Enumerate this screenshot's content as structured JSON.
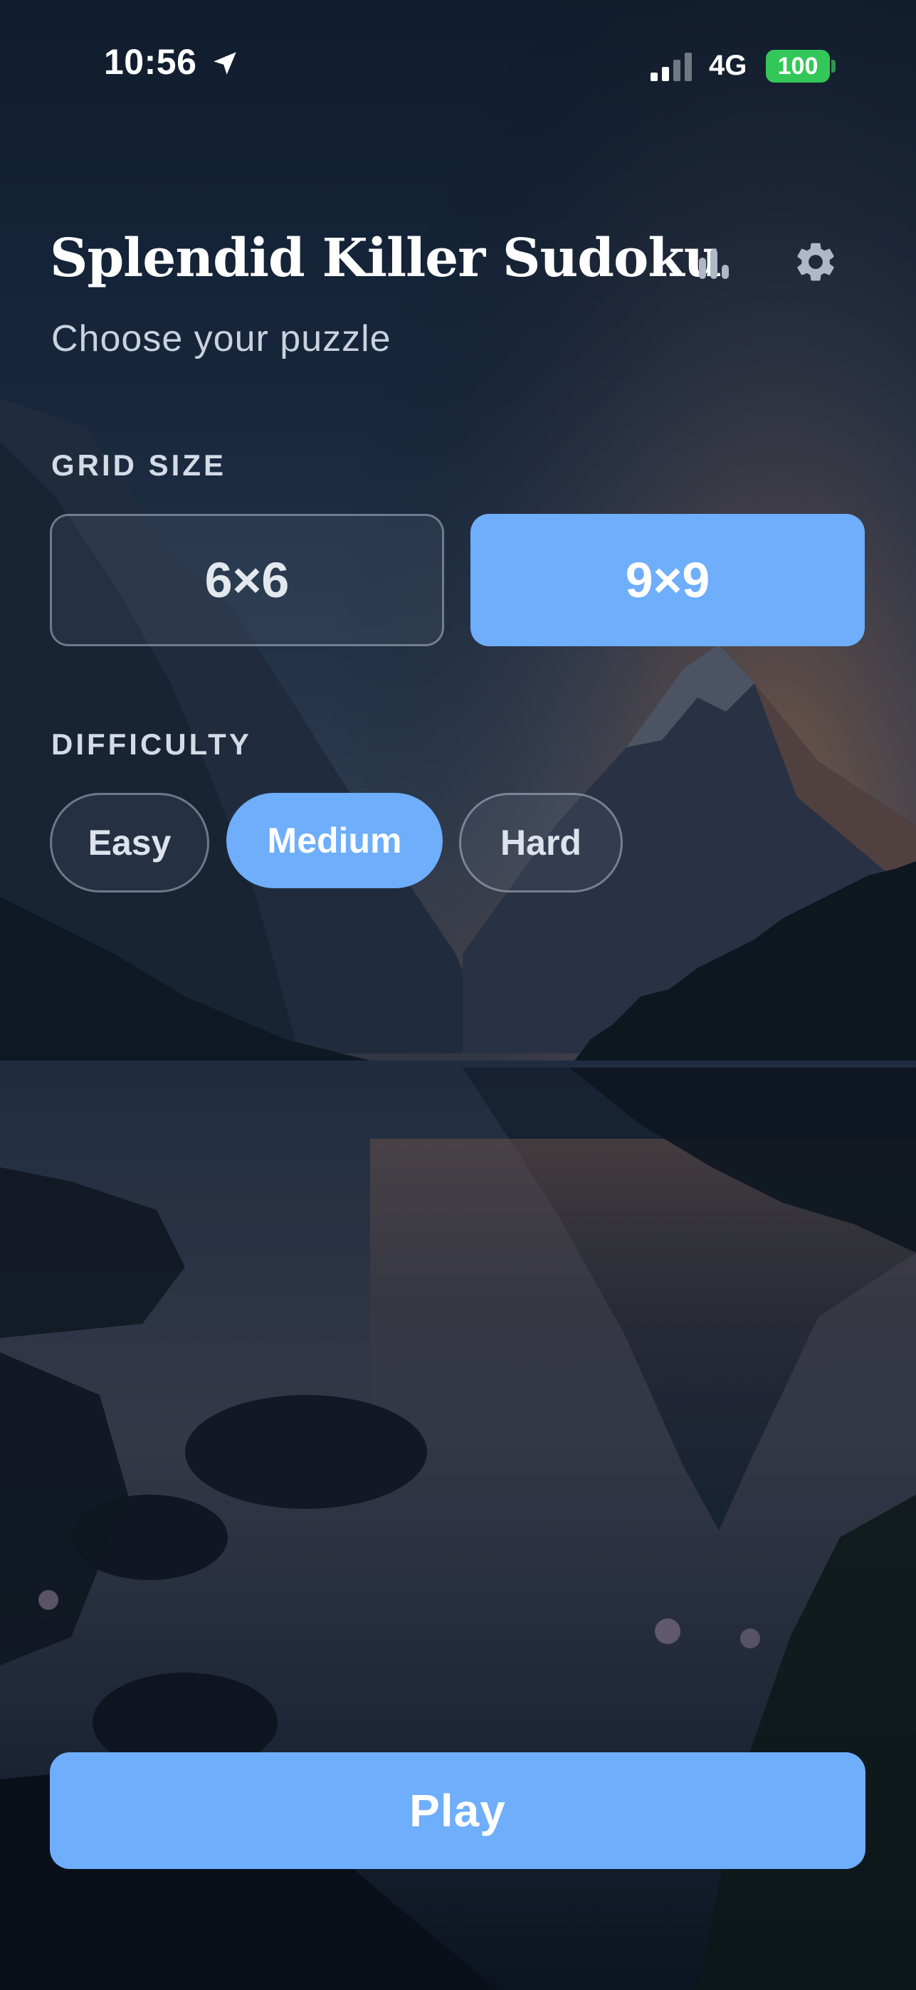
{
  "status_bar": {
    "time": "10:56",
    "network": "4G",
    "battery": "100",
    "location_icon": "location-arrow-icon",
    "signal_icon": "cellular-signal-icon"
  },
  "header": {
    "title": "Splendid Killer Sudoku",
    "subtitle": "Choose your puzzle",
    "stats_icon": "bar-chart-icon",
    "settings_icon": "gear-icon"
  },
  "grid_size": {
    "label": "GRID SIZE",
    "options": [
      {
        "label": "6×6",
        "selected": false
      },
      {
        "label": "9×9",
        "selected": true
      }
    ]
  },
  "difficulty": {
    "label": "DIFFICULTY",
    "options": [
      {
        "label": "Easy",
        "selected": false
      },
      {
        "label": "Medium",
        "selected": true
      },
      {
        "label": "Hard",
        "selected": false
      }
    ]
  },
  "play_button": {
    "label": "Play"
  },
  "colors": {
    "accent": "#6eaefb",
    "battery": "#33c759",
    "text_primary": "#ffffff",
    "text_secondary": "#c9d2de"
  }
}
